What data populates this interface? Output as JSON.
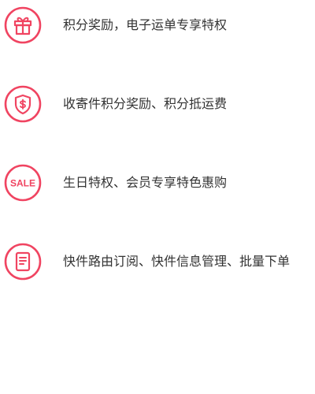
{
  "colors": {
    "accent": "#F04461",
    "text": "#333333",
    "background": "#FFFFFF"
  },
  "benefits": [
    {
      "icon": "gift-icon",
      "label": "积分奖励，电子运单专享特权"
    },
    {
      "icon": "shield-dollar-icon",
      "label": "收寄件积分奖励、积分抵运费"
    },
    {
      "icon": "sale-icon",
      "icon_text": "SALE",
      "label": "生日特权、会员专享特色惠购"
    },
    {
      "icon": "document-icon",
      "label": "快件路由订阅、快件信息管理、批量下单"
    }
  ]
}
